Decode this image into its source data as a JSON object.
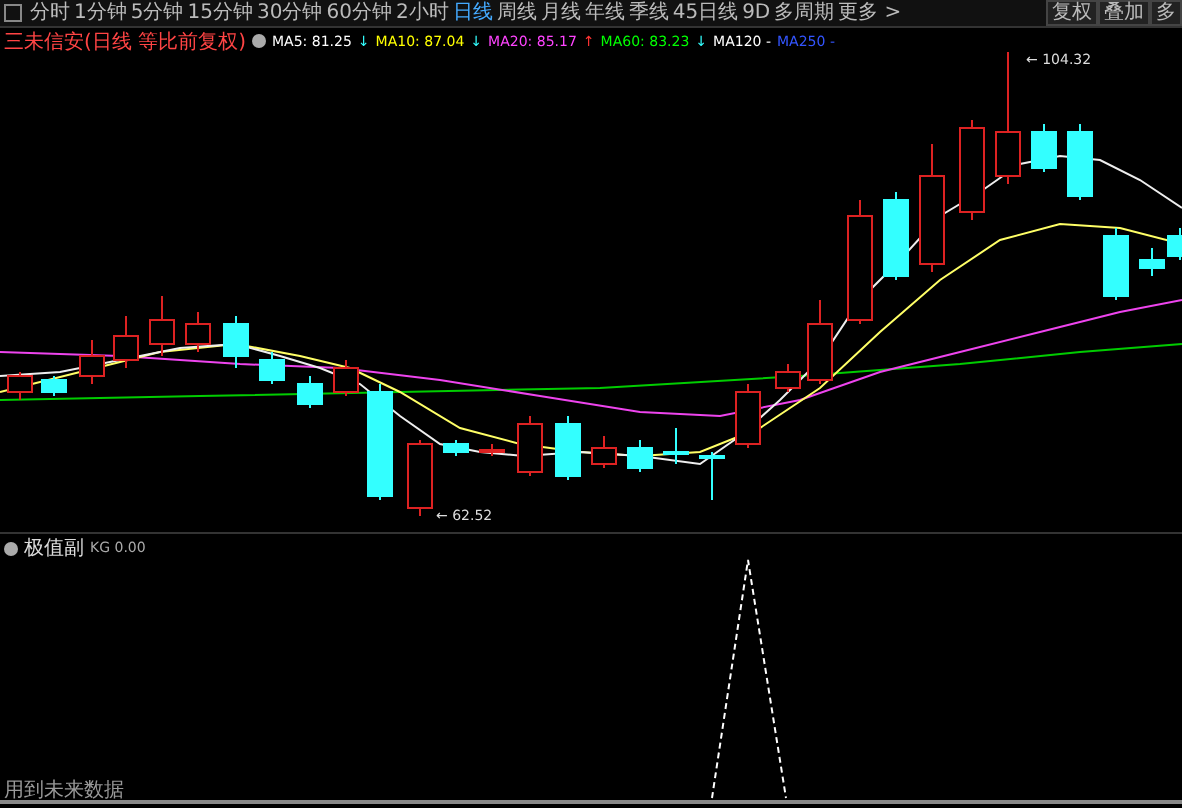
{
  "toolbar": {
    "tabs": [
      {
        "label": "分时",
        "selected": false
      },
      {
        "label": "1分钟",
        "selected": false
      },
      {
        "label": "5分钟",
        "selected": false
      },
      {
        "label": "15分钟",
        "selected": false
      },
      {
        "label": "30分钟",
        "selected": false
      },
      {
        "label": "60分钟",
        "selected": false
      },
      {
        "label": "2小时",
        "selected": false
      },
      {
        "label": "日线",
        "selected": true
      },
      {
        "label": "周线",
        "selected": false
      },
      {
        "label": "月线",
        "selected": false
      },
      {
        "label": "年线",
        "selected": false
      },
      {
        "label": "季线",
        "selected": false
      },
      {
        "label": "45日线",
        "selected": false
      },
      {
        "label": "9D",
        "selected": false
      },
      {
        "label": "多周期",
        "selected": false
      },
      {
        "label": "更多 >",
        "selected": false
      }
    ],
    "right_buttons": [
      "复权",
      "叠加",
      "多"
    ]
  },
  "legend": {
    "title": "三未信安(日线 等比前复权)",
    "items": [
      {
        "label": "MA5:",
        "value": "81.25",
        "arrow": "↓",
        "rising": false,
        "color": "#ffffff"
      },
      {
        "label": "MA10:",
        "value": "87.04",
        "arrow": "↓",
        "rising": false,
        "color": "#ffff00"
      },
      {
        "label": "MA20:",
        "value": "85.17",
        "arrow": "↑",
        "rising": true,
        "color": "#ff44ff"
      },
      {
        "label": "MA60:",
        "value": "83.23",
        "arrow": "↓",
        "rising": false,
        "color": "#00ff00"
      },
      {
        "label": "MA120",
        "value": "-",
        "color": "#ffffff"
      },
      {
        "label": "MA250",
        "value": "-",
        "color": "#3355ff"
      }
    ]
  },
  "price_marks": [
    {
      "kind": "high",
      "label": "← 104.32"
    },
    {
      "kind": "low",
      "label": "← 62.52"
    }
  ],
  "indicator": {
    "title": "极值副",
    "formula": "KG 0.00"
  },
  "footer_note": "用到未来数据"
}
